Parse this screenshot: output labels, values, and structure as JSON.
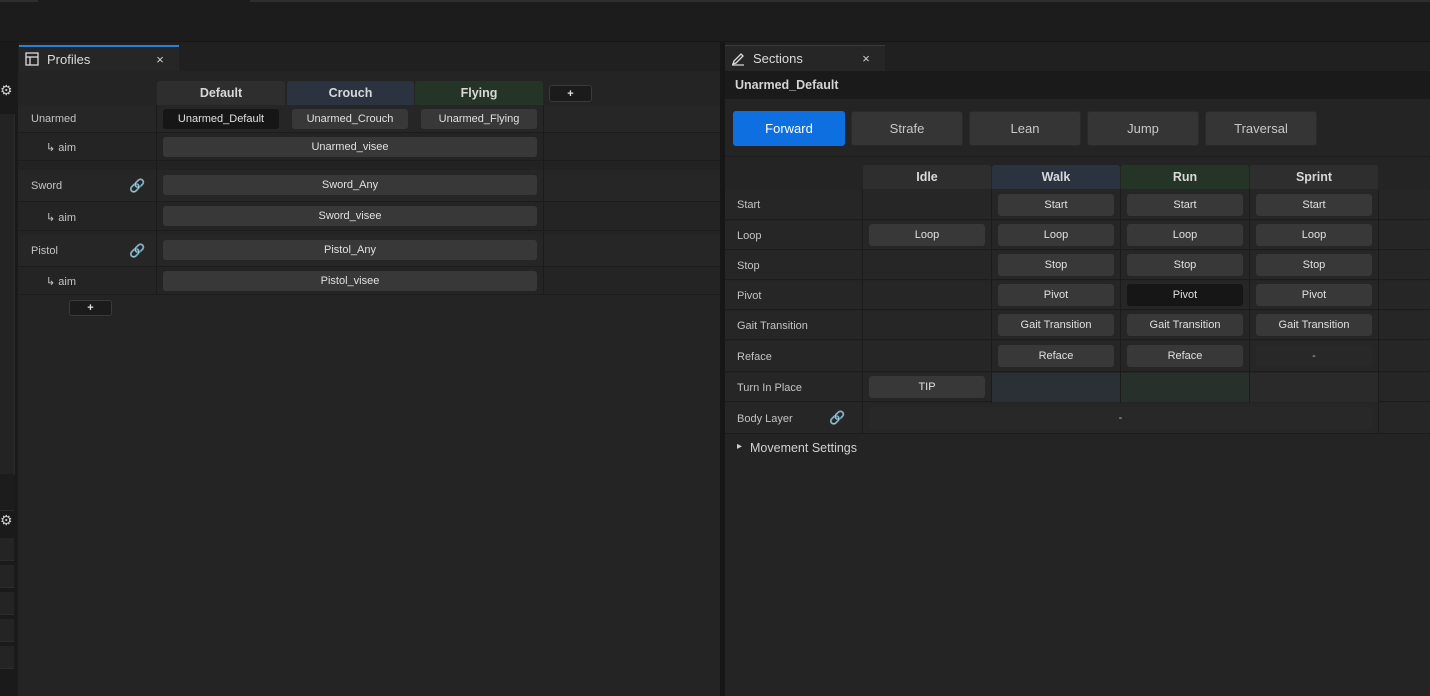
{
  "colors": {
    "accent": "#0e70e0",
    "crouch_header": "#2b3340",
    "flying_header": "#243528",
    "walk_header": "#2b3340",
    "run_header": "#243528"
  },
  "profiles": {
    "tab_label": "Profiles",
    "close": "×",
    "add_column": "+",
    "add_row": "+",
    "columns": [
      "Default",
      "Crouch",
      "Flying"
    ],
    "rows": {
      "unarmed": {
        "label": "Unarmed",
        "cells": [
          "Unarmed_Default",
          "Unarmed_Crouch",
          "Unarmed_Flying"
        ]
      },
      "unarmed_aim": {
        "label": "↳ aim",
        "cell": "Unarmed_visee"
      },
      "sword": {
        "label": "Sword",
        "cell": "Sword_Any"
      },
      "sword_aim": {
        "label": "↳ aim",
        "cell": "Sword_visee"
      },
      "pistol": {
        "label": "Pistol",
        "cell": "Pistol_Any"
      },
      "pistol_aim": {
        "label": "↳ aim",
        "cell": "Pistol_visee"
      }
    }
  },
  "sections": {
    "tab_label": "Sections",
    "close": "×",
    "title": "Unarmed_Default",
    "nav": [
      "Forward",
      "Strafe",
      "Lean",
      "Jump",
      "Traversal"
    ],
    "nav_active": "Forward",
    "columns": [
      "Idle",
      "Walk",
      "Run",
      "Sprint"
    ],
    "rows": {
      "start": {
        "label": "Start",
        "walk": "Start",
        "run": "Start",
        "sprint": "Start"
      },
      "loop": {
        "label": "Loop",
        "idle": "Loop",
        "walk": "Loop",
        "run": "Loop",
        "sprint": "Loop"
      },
      "stop": {
        "label": "Stop",
        "walk": "Stop",
        "run": "Stop",
        "sprint": "Stop"
      },
      "pivot": {
        "label": "Pivot",
        "walk": "Pivot",
        "run": "Pivot",
        "sprint": "Pivot"
      },
      "gait": {
        "label": "Gait Transition",
        "walk": "Gait Transition",
        "run": "Gait Transition",
        "sprint": "Gait Transition"
      },
      "reface": {
        "label": "Reface",
        "walk": "Reface",
        "run": "Reface",
        "sprint": "-"
      },
      "tip": {
        "label": "Turn In Place",
        "idle": "TIP"
      },
      "body": {
        "label": "Body Layer",
        "value": "-"
      }
    },
    "movement_settings": "Movement Settings",
    "expand_arrow": "▸"
  }
}
